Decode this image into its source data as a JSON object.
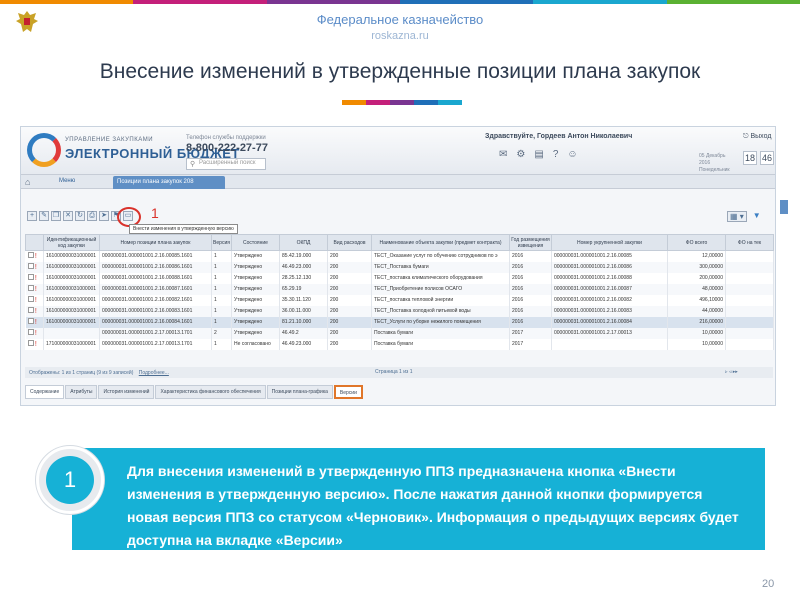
{
  "colors": {
    "topbar": [
      "#f08a00",
      "#c4207a",
      "#7a3591",
      "#1f6fb8",
      "#1aa7cf",
      "#5bb132"
    ],
    "accent": [
      "#f08a00",
      "#c4207a",
      "#7a3591",
      "#1f6fb8",
      "#1aa7cf"
    ],
    "info_bg": "#16b1d6",
    "highlight_red": "#d9322b",
    "highlight_orange": "#e0762a"
  },
  "header": {
    "org": "Федеральное казначейство",
    "url": "roskazna.ru",
    "emblem_icon": "double-headed-eagle-icon"
  },
  "slide_title": "Внесение изменений в утвержденные позиции плана закупок",
  "app": {
    "logo_sub": "УПРАВЛЕНИЕ ЗАКУПКАМИ",
    "logo_main": "ЭЛЕКТРОННЫЙ БЮДЖЕТ",
    "support_label": "Телефон службы поддержки",
    "support_phone": "8-800-222-27-77",
    "search_placeholder": "Расширенный поиск",
    "greeting": "Здравствуйте, Гордеев Антон Николаевич",
    "exit_label": "Выход",
    "date_text": "05 Декабрь 2016 Понедельник",
    "clock_h": "18",
    "clock_m": "46",
    "home_icon": "home-icon",
    "menu_label": "Меню",
    "tab_label": "Позиции плана закупок 208",
    "tooltip": "Внести изменения в утвержденную версию",
    "marker": "1"
  },
  "grid": {
    "columns": [
      "",
      "Идентификационный код закупки",
      "Номер позиции плана закупок",
      "Версия",
      "Состояние",
      "ОКПД",
      "Вид расходов",
      "Наименование объекта закупки (предмет контракта)",
      "Год размещения извещения",
      "Номер укрупненной закупки",
      "ФО всего",
      "ФО на тек"
    ],
    "rows": [
      [
        "161000000031000001",
        "000000031.000001001.2.16.00085.1601",
        "1",
        "Утверждено",
        "85.42.19.000",
        "200",
        "ТЕСТ_Оказание услуг по обучению сотрудников по э",
        "2016",
        "000000031.000001001.2.16.00085",
        "12,00000"
      ],
      [
        "161000000031000001",
        "000000031.000001001.2.16.00086.1601",
        "1",
        "Утверждено",
        "46.49.23.000",
        "200",
        "ТЕСТ_Поставка бумаги",
        "2016",
        "000000031.000001001.2.16.00086",
        "300,00000"
      ],
      [
        "161000000031000001",
        "000000031.000001001.2.16.00088.1601",
        "1",
        "Утверждено",
        "28.25.12.130",
        "200",
        "ТЕСТ_поставка климатического оборудования",
        "2016",
        "000000031.000001001.2.16.00088",
        "200,00000"
      ],
      [
        "161000000031000001",
        "000000031.000001001.2.16.00087.1601",
        "1",
        "Утверждено",
        "65.29.19",
        "200",
        "ТЕСТ_Приобретение полисов ОСАГО",
        "2016",
        "000000031.000001001.2.16.00087",
        "48,00000"
      ],
      [
        "161000000031000001",
        "000000031.000001001.2.16.00082.1601",
        "1",
        "Утверждено",
        "35.30.11.120",
        "200",
        "ТЕСТ_поставка тепловой энергии",
        "2016",
        "000000031.000001001.2.16.00082",
        "496,10000"
      ],
      [
        "161000000031000001",
        "000000031.000001001.2.16.00083.1601",
        "1",
        "Утверждено",
        "36.00.11.000",
        "200",
        "ТЕСТ_Поставка холодной питьевой воды",
        "2016",
        "000000031.000001001.2.16.00083",
        "44,00000"
      ],
      [
        "161000000031000001",
        "000000031.000001001.2.16.00084.1601",
        "1",
        "Утверждено",
        "81.21.10.000",
        "200",
        "ТЕСТ_Услуги по уборке нежилого помещения",
        "2016",
        "000000031.000001001.2.16.00084",
        "216,00000"
      ],
      [
        "",
        "000000031.000001001.2.17.00013.1701",
        "2",
        "Утверждено",
        "46.49.2",
        "200",
        "Поставка бумаги",
        "2017",
        "000000031.000001001.2.17.00013",
        "10,00000"
      ],
      [
        "171000000031000001",
        "000000031.000001001.2.17.00013.1701",
        "1",
        "Не согласовано",
        "46.49.23.000",
        "200",
        "Поставка бумаги",
        "2017",
        "",
        "10,00000"
      ]
    ]
  },
  "pager": {
    "left": "Отображены: 1 из 1 страниц (9 из 9 записей)",
    "more": "Подробнее...",
    "mid": "Страница 1 из 1",
    "right": "▹ ◃ ▸▸"
  },
  "bottom_tabs": [
    "Содержание",
    "Атрибуты",
    "История изменений",
    "Характеристика финансового обеспечения",
    "Позиции плана-графика",
    "Версии"
  ],
  "callout": {
    "number": "1",
    "text": "Для внесения изменений в утвержденную ППЗ предназначена кнопка «Внести изменения в утвержденную версию». После нажатия данной кнопки формируется новая версия ППЗ со статусом «Черновик». Информация о предыдущих версиях будет доступна на вкладке «Версии»"
  },
  "page_number": "20"
}
